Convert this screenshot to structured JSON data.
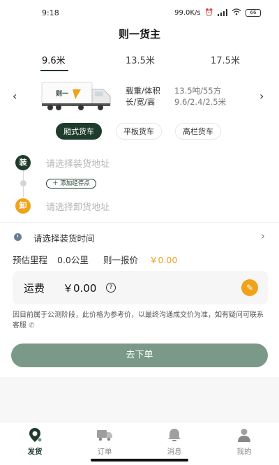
{
  "status_bar": {
    "time": "9:18",
    "network_speed": "99.0K/s",
    "battery": "66"
  },
  "header": {
    "title": "则一货主"
  },
  "length_tabs": [
    {
      "label": "9.6米",
      "active": true
    },
    {
      "label": "13.5米",
      "active": false
    },
    {
      "label": "17.5米",
      "active": false
    }
  ],
  "truck": {
    "brand_text": "则一",
    "load_label": "载重/体积",
    "load_value": "13.5吨/55方",
    "size_label": "长/宽/高",
    "size_value": "9.6/2.4/2.5米"
  },
  "truck_types": [
    {
      "label": "厢式货车",
      "active": true
    },
    {
      "label": "平板货车",
      "active": false
    },
    {
      "label": "高栏货车",
      "active": false
    }
  ],
  "address": {
    "load_badge": "装",
    "load_placeholder": "请选择装货地址",
    "add_stop": "添加经停点",
    "unload_badge": "卸",
    "unload_placeholder": "请选择卸货地址"
  },
  "time": {
    "placeholder": "请选择装货时间"
  },
  "estimate": {
    "mileage_label": "预估里程",
    "mileage_value": "0.0公里",
    "quote_label": "则一报价",
    "quote_value": "￥0.00"
  },
  "fee": {
    "label": "运费",
    "value": "￥0.00"
  },
  "notice": "因目前属于公测阶段，此价格为参考价，以最终沟通成交价为准，如有疑问可联系客服",
  "submit_label": "去下单",
  "nav": [
    {
      "label": "发货",
      "icon": "location-pin-icon",
      "active": true
    },
    {
      "label": "订单",
      "icon": "truck-icon",
      "active": false
    },
    {
      "label": "消息",
      "icon": "bell-icon",
      "active": false
    },
    {
      "label": "我的",
      "icon": "user-icon",
      "active": false
    }
  ],
  "colors": {
    "primary": "#1f3b2c",
    "accent": "#f0a21a",
    "button": "#7a9989"
  }
}
